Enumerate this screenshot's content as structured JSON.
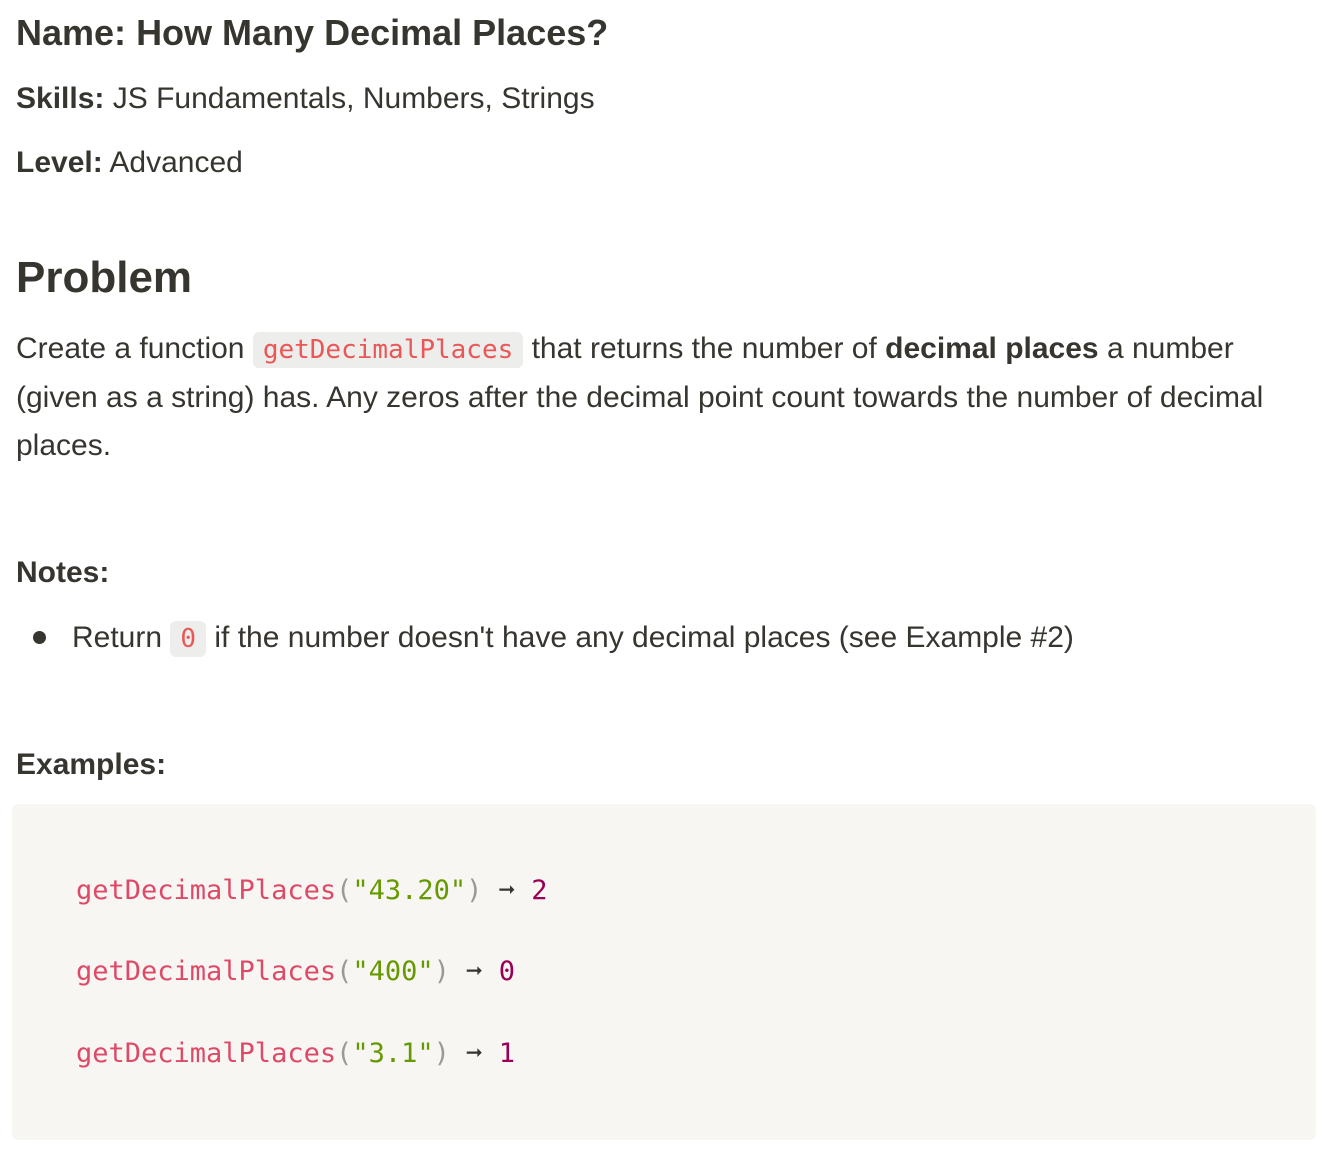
{
  "header": {
    "name_label": "Name:",
    "name_value": "How Many Decimal Places?",
    "skills_label": "Skills:",
    "skills_value": "JS Fundamentals, Numbers, Strings",
    "level_label": "Level:",
    "level_value": "Advanced"
  },
  "problem": {
    "heading": "Problem",
    "text_before_code": "Create a function ",
    "function_name": "getDecimalPlaces",
    "text_after_code": " that returns the number of ",
    "bold_phrase": "decimal places",
    "text_end": " a number (given as a string) has. Any zeros after the decimal point count towards the number of decimal places."
  },
  "notes": {
    "heading": "Notes:",
    "items": [
      {
        "before": "Return ",
        "code": "0",
        "after": " if the number doesn't have any decimal places (see Example #2)"
      }
    ]
  },
  "examples": {
    "heading": "Examples:",
    "lines": [
      {
        "fn": "getDecimalPlaces",
        "open": "(",
        "arg": "\"43.20\"",
        "close": ")",
        "arrow": "➞",
        "result": "2"
      },
      {
        "fn": "getDecimalPlaces",
        "open": "(",
        "arg": "\"400\"",
        "close": ")",
        "arrow": "➞",
        "result": "0"
      },
      {
        "fn": "getDecimalPlaces",
        "open": "(",
        "arg": "\"3.1\"",
        "close": ")",
        "arrow": "➞",
        "result": "1"
      }
    ]
  },
  "colors": {
    "text": "#37352f",
    "inline_code": "#eb5757",
    "code_fn": "#dd4a68",
    "code_str": "#669900",
    "code_num": "#990055",
    "code_bg": "#f7f6f3"
  }
}
